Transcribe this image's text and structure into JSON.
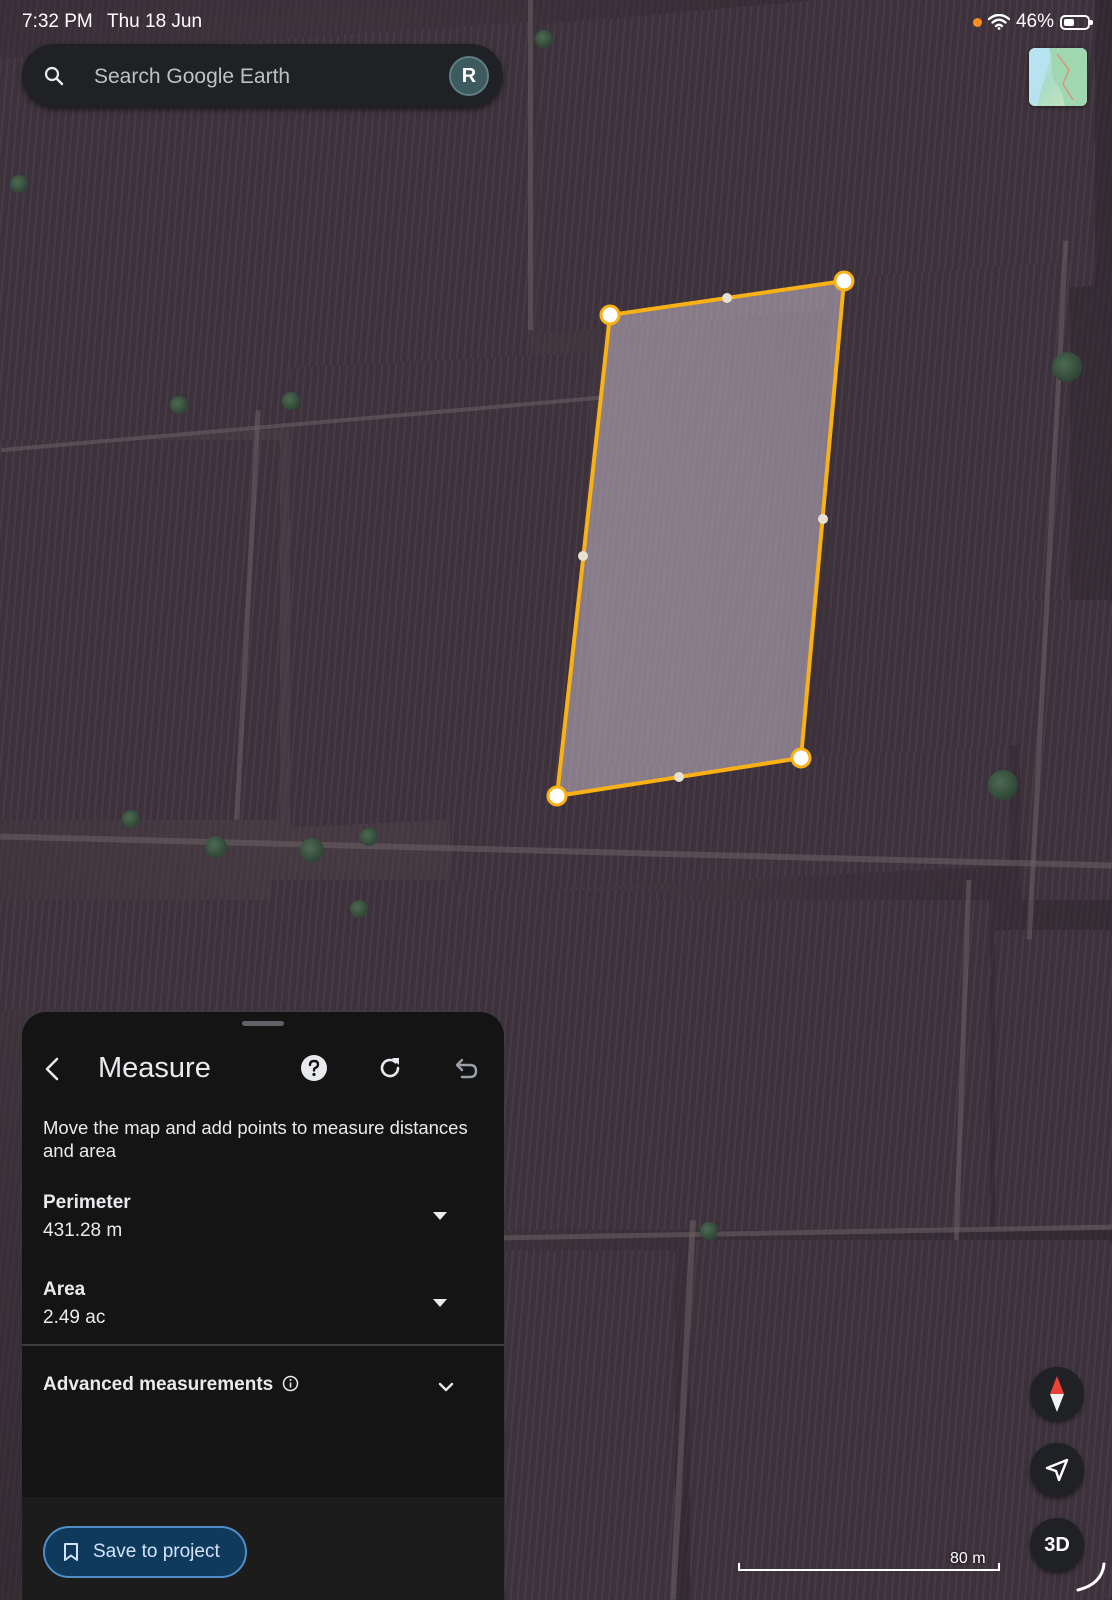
{
  "status_bar": {
    "time": "7:32 PM",
    "date": "Thu 18 Jun",
    "battery": "46%"
  },
  "search": {
    "placeholder": "Search Google Earth",
    "avatar_initial": "R"
  },
  "measure_panel": {
    "title": "Measure",
    "description": "Move the map and add points to measure distances and area",
    "perimeter_label": "Perimeter",
    "perimeter_value": "431.28 m",
    "area_label": "Area",
    "area_value": "2.49 ac",
    "advanced_label": "Advanced measurements",
    "save_label": "Save to project"
  },
  "map": {
    "scale_label": "80 m",
    "button_3d": "3D",
    "outline_color": "#f9b115"
  },
  "icons": {
    "search": "search-icon",
    "back": "chevron-left-icon",
    "help": "help-icon",
    "refresh": "refresh-icon",
    "undo": "undo-icon",
    "info": "info-icon",
    "expand": "chevron-down-icon",
    "bookmark": "bookmark-icon",
    "compass": "compass-icon",
    "locate": "navigation-icon"
  }
}
